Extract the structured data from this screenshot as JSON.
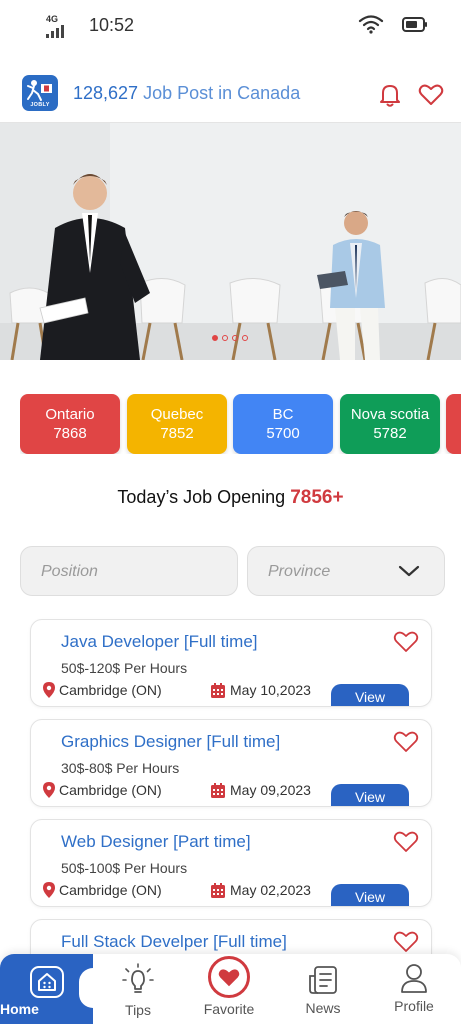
{
  "status_bar": {
    "network": "4G",
    "time": "10:52"
  },
  "header": {
    "logo_text": "JOBLY",
    "job_count": "128,627",
    "title_suffix": "Job Post in Canada"
  },
  "banner": {
    "slide_count": 4,
    "active_slide": 1
  },
  "provinces": [
    {
      "name": "Ontario",
      "count": "7868",
      "color": "#e04545"
    },
    {
      "name": "Quebec",
      "count": "7852",
      "color": "#f4b400"
    },
    {
      "name": "BC",
      "count": "5700",
      "color": "#4285f4"
    },
    {
      "name": "Nova scotia",
      "count": "5782",
      "color": "#0f9d58"
    }
  ],
  "opening": {
    "label": "Today’s Job Opening",
    "count": "7856+"
  },
  "filters": {
    "position_placeholder": "Position",
    "province_placeholder": "Province"
  },
  "jobs": [
    {
      "title": "Java Developer [Full time]",
      "salary": "50$-120$ Per Hours",
      "location": "Cambridge (ON)",
      "date": "May 10,2023",
      "action": "View"
    },
    {
      "title": "Graphics Designer [Full time]",
      "salary": "30$-80$ Per Hours",
      "location": "Cambridge (ON)",
      "date": "May 09,2023",
      "action": "View"
    },
    {
      "title": "Web Designer [Part time]",
      "salary": "50$-100$ Per Hours",
      "location": "Cambridge (ON)",
      "date": "May 02,2023",
      "action": "View"
    },
    {
      "title": "Full Stack Develper [Full time]"
    }
  ],
  "nav": {
    "home": "Home",
    "tips": "Tips",
    "favorite": "Favorite",
    "news": "News",
    "profile": "Profile"
  },
  "colors": {
    "brand_blue": "#2a63c2",
    "accent_red": "#d03a3f"
  }
}
